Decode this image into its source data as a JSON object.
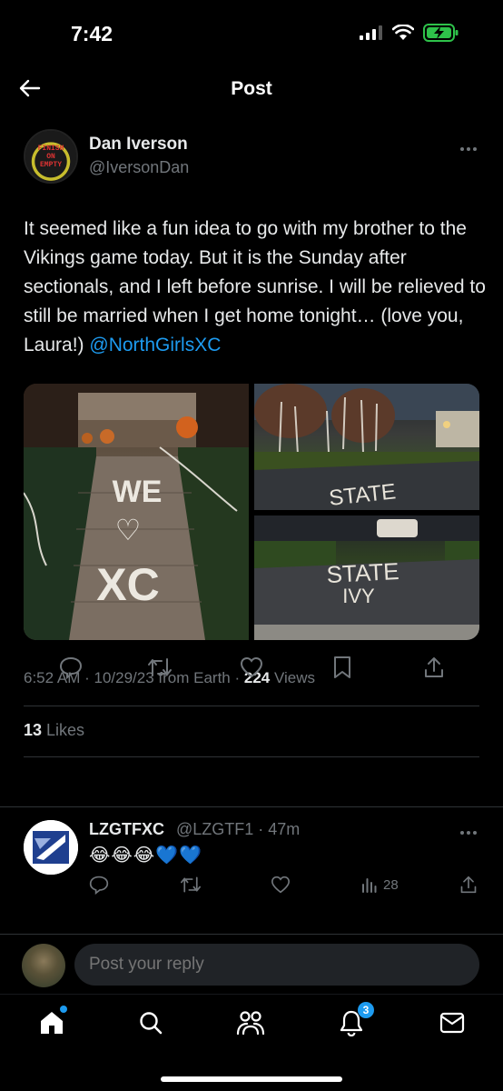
{
  "status_bar": {
    "time": "7:42"
  },
  "header": {
    "title": "Post"
  },
  "post": {
    "author_name": "Dan Iverson",
    "author_handle": "@IversonDan",
    "avatar_text": [
      "FINISH",
      "ON",
      "EMPTY"
    ],
    "text": "It seemed like a fun idea to go with my brother to the Vikings game today. But it is the Sunday after sectionals, and I left before sunrise. I will be relieved to still be married when I get home tonight… (love you, Laura!) ",
    "mention": "@NorthGirlsXC",
    "time": "6:52 AM",
    "date": "10/29/23",
    "source": "from Earth",
    "views_count": "224",
    "views_label": " Views",
    "likes_count": "13",
    "likes_label": " Likes",
    "photo_texts": {
      "left": [
        "WE",
        "♡",
        "XC"
      ],
      "top_right": "STATE",
      "bottom_right": [
        "STATE",
        "IVY"
      ]
    }
  },
  "reply": {
    "name": "LZGTFXC",
    "handle": "@LZGTF1 · 47m",
    "text": "😂😂😂💙💙",
    "views": "28"
  },
  "composer": {
    "placeholder": "Post your reply"
  },
  "tabbar": {
    "notifications_badge": "3"
  },
  "colors": {
    "accent": "#1d9bf0",
    "background": "#000000",
    "secondary_text": "#71767b"
  }
}
